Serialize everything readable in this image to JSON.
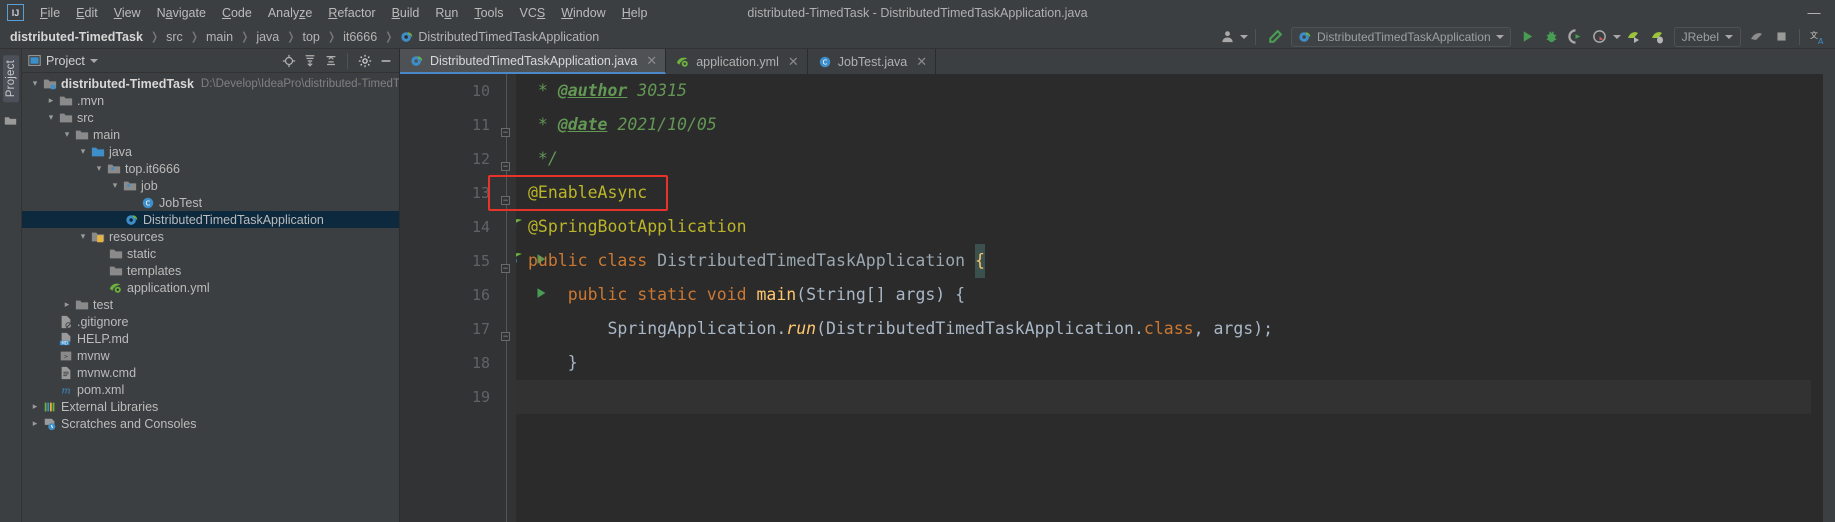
{
  "window": {
    "title": "distributed-TimedTask - DistributedTimedTaskApplication.java",
    "minimize": "—",
    "maximize": "❐",
    "close": "✕"
  },
  "menubar": {
    "logo": "IJ",
    "items": [
      {
        "label": "File"
      },
      {
        "label": "Edit"
      },
      {
        "label": "View"
      },
      {
        "label": "Navigate"
      },
      {
        "label": "Code"
      },
      {
        "label": "Analyze"
      },
      {
        "label": "Refactor"
      },
      {
        "label": "Build"
      },
      {
        "label": "Run"
      },
      {
        "label": "Tools"
      },
      {
        "label": "VCS"
      },
      {
        "label": "Window"
      },
      {
        "label": "Help"
      }
    ]
  },
  "breadcrumbs": [
    {
      "label": "distributed-TimedTask",
      "root": true
    },
    {
      "label": "src"
    },
    {
      "label": "main"
    },
    {
      "label": "java"
    },
    {
      "label": "top"
    },
    {
      "label": "it6666"
    },
    {
      "label": "DistributedTimedTaskApplication",
      "icon": "spring-class-icon"
    }
  ],
  "toolbar": {
    "run_config": "DistributedTimedTaskApplication",
    "jrebel": "JRebel",
    "icons": [
      "user-avatar-icon",
      "update-project-icon",
      "run-icon",
      "debug-icon",
      "run-with-coverage-icon",
      "profiler-icon",
      "jrebel-run-icon",
      "jrebel-debug-icon",
      "stop-icon",
      "build-icon",
      "translate-icon"
    ]
  },
  "left_strip": {
    "label": "Project",
    "icon": "structure-icon"
  },
  "project_panel": {
    "title": "Project",
    "tools": [
      "locate-icon",
      "expand-all-icon",
      "collapse-all-icon",
      "gear-icon",
      "hide-icon"
    ],
    "tree": [
      {
        "label": "distributed-TimedTask",
        "path": "D:\\Develop\\IdeaPro\\distributed-TimedTask",
        "indent": 0,
        "arrow": "down",
        "icon": "module-icon",
        "bold": true
      },
      {
        "label": ".mvn",
        "indent": 1,
        "arrow": "right",
        "icon": "folder-icon"
      },
      {
        "label": "src",
        "indent": 1,
        "arrow": "down",
        "icon": "folder-icon"
      },
      {
        "label": "main",
        "indent": 2,
        "arrow": "down",
        "icon": "folder-icon"
      },
      {
        "label": "java",
        "indent": 3,
        "arrow": "down",
        "icon": "source-folder-icon"
      },
      {
        "label": "top.it6666",
        "indent": 4,
        "arrow": "down",
        "icon": "package-icon"
      },
      {
        "label": "job",
        "indent": 5,
        "arrow": "down",
        "icon": "package-icon"
      },
      {
        "label": "JobTest",
        "indent": 6,
        "arrow": "none",
        "icon": "java-class-icon"
      },
      {
        "label": "DistributedTimedTaskApplication",
        "indent": 5,
        "arrow": "none",
        "icon": "spring-class-icon",
        "selected": true
      },
      {
        "label": "resources",
        "indent": 3,
        "arrow": "down",
        "icon": "resources-folder-icon"
      },
      {
        "label": "static",
        "indent": 4,
        "arrow": "none",
        "icon": "folder-icon"
      },
      {
        "label": "templates",
        "indent": 4,
        "arrow": "none",
        "icon": "folder-icon"
      },
      {
        "label": "application.yml",
        "indent": 4,
        "arrow": "none",
        "icon": "spring-yml-icon"
      },
      {
        "label": "test",
        "indent": 2,
        "arrow": "right",
        "icon": "folder-icon"
      },
      {
        "label": ".gitignore",
        "indent": 1,
        "arrow": "none",
        "icon": "gitignore-icon"
      },
      {
        "label": "HELP.md",
        "indent": 1,
        "arrow": "none",
        "icon": "markdown-icon"
      },
      {
        "label": "mvnw",
        "indent": 1,
        "arrow": "none",
        "icon": "shell-script-icon"
      },
      {
        "label": "mvnw.cmd",
        "indent": 1,
        "arrow": "none",
        "icon": "cmd-script-icon"
      },
      {
        "label": "pom.xml",
        "indent": 1,
        "arrow": "none",
        "icon": "maven-icon"
      },
      {
        "label": "External Libraries",
        "indent": 0,
        "arrow": "right",
        "icon": "libraries-icon"
      },
      {
        "label": "Scratches and Consoles",
        "indent": 0,
        "arrow": "right",
        "icon": "scratches-icon"
      }
    ]
  },
  "editor": {
    "tabs": [
      {
        "label": "DistributedTimedTaskApplication.java",
        "icon": "spring-class-icon",
        "active": true,
        "close": "✕"
      },
      {
        "label": "application.yml",
        "icon": "spring-yml-icon",
        "active": false,
        "close": "✕"
      },
      {
        "label": "JobTest.java",
        "icon": "java-class-icon",
        "active": false,
        "close": "✕"
      }
    ],
    "lines": [
      {
        "num": "10",
        "gutter_icons": []
      },
      {
        "num": "11",
        "gutter_icons": []
      },
      {
        "num": "12",
        "gutter_icons": []
      },
      {
        "num": "13",
        "gutter_icons": []
      },
      {
        "num": "14",
        "gutter_icons": [
          "spring-bean-icon"
        ]
      },
      {
        "num": "15",
        "gutter_icons": [
          "spring-bean-icon",
          "run-gutter-icon"
        ]
      },
      {
        "num": "16",
        "gutter_icons": [
          "run-gutter-icon"
        ]
      },
      {
        "num": "17",
        "gutter_icons": []
      },
      {
        "num": "18",
        "gutter_icons": []
      },
      {
        "num": "19",
        "gutter_icons": []
      }
    ],
    "code": {
      "l10_star": " * ",
      "l10_tag": "@author",
      "l10_val": " 30315",
      "l11_star": " * ",
      "l11_tag": "@date",
      "l11_val": " 2021/10/05",
      "l12": " */",
      "l13": "@EnableAsync",
      "l14": "@SpringBootApplication",
      "l15_kw1": "public ",
      "l15_kw2": "class ",
      "l15_name": "DistributedTimedTaskApplication ",
      "l15_brace": "{",
      "l16_kw": "    public static void ",
      "l16_mth": "main",
      "l16_rest": "(String[] args) {",
      "l17_a": "        SpringApplication.",
      "l17_run": "run",
      "l17_b": "(DistributedTimedTaskApplication.",
      "l17_class": "class",
      "l17_c": ", args);",
      "l18": "    }",
      "l19": "}"
    },
    "highlight_box": {
      "label": "enable-async-highlight",
      "color": "#e8332a"
    }
  }
}
